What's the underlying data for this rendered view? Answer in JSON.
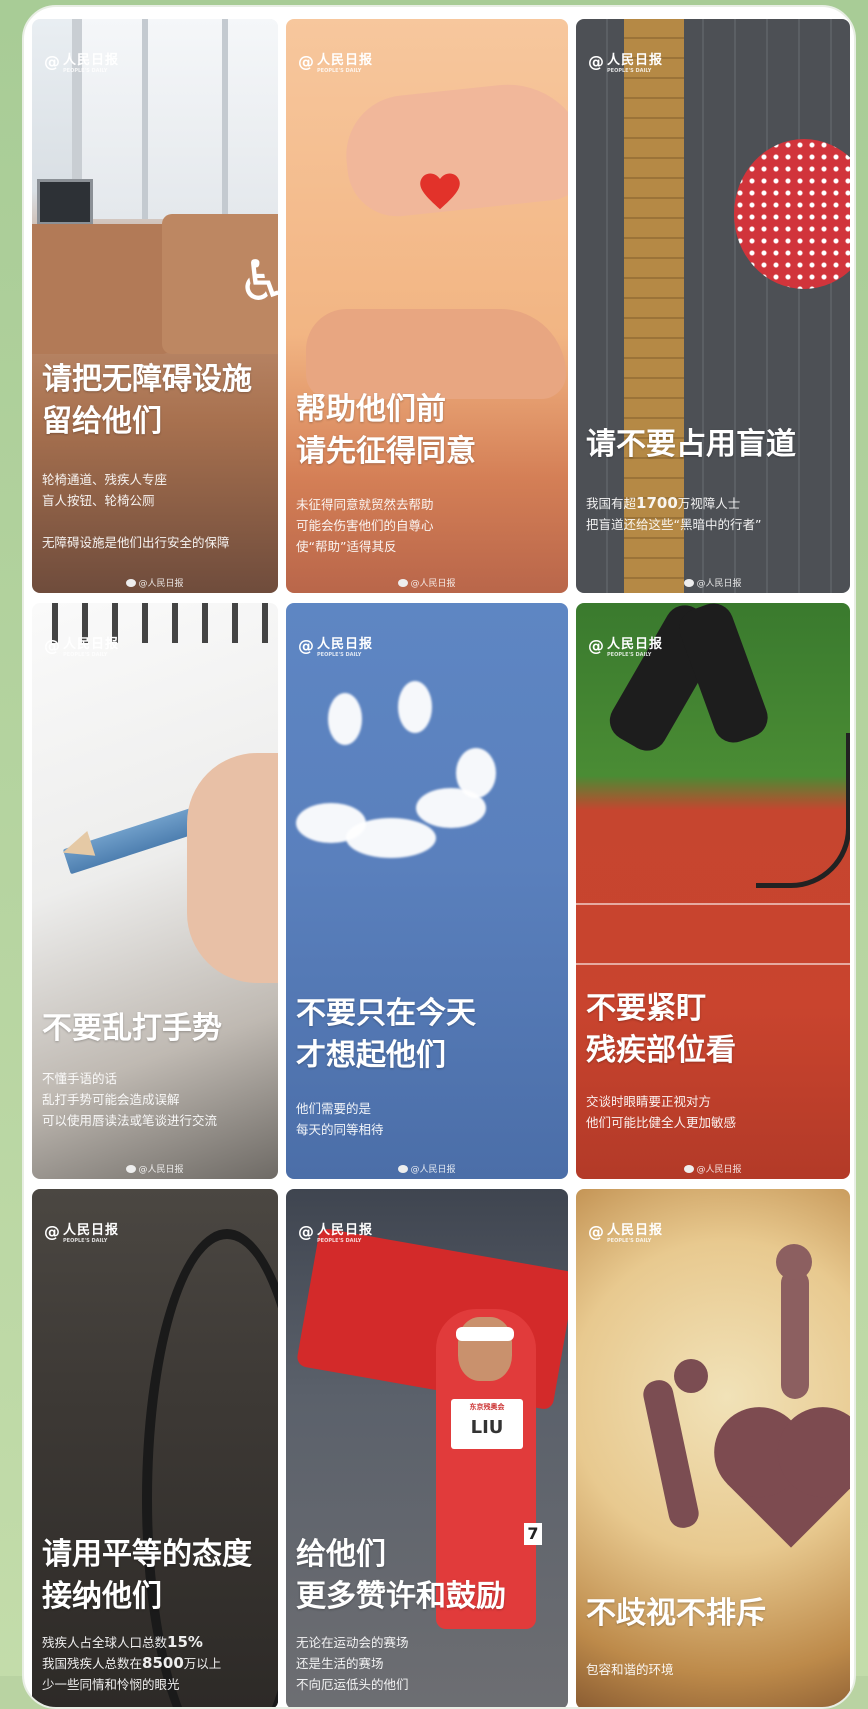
{
  "logo": {
    "at": "@",
    "name": "人民日报",
    "sub": "PEOPLE'S DAILY"
  },
  "watermark": "@人民日报",
  "cards": [
    {
      "headline": [
        "请把无障碍设施",
        "留给他们"
      ],
      "body": [
        "轮椅通道、残疾人专座",
        "盲人按钮、轮椅公厕",
        "",
        "无障碍设施是他们出行安全的保障"
      ]
    },
    {
      "headline": [
        "帮助他们前",
        "请先征得同意"
      ],
      "body": [
        "未征得同意就贸然去帮助",
        "可能会伤害他们的自尊心",
        "使“帮助”适得其反"
      ]
    },
    {
      "headline": [
        "请不要占用盲道"
      ],
      "body_prefix": "我国有超",
      "body_number": "1700",
      "body_suffix": "万视障人士",
      "body": [
        "把盲道还给这些“黑暗中的行者”"
      ]
    },
    {
      "headline": [
        "不要乱打手势"
      ],
      "body": [
        "不懂手语的话",
        "乱打手势可能会造成误解",
        "可以使用唇读法或笔谈进行交流"
      ]
    },
    {
      "headline": [
        "不要只在今天",
        "才想起他们"
      ],
      "body": [
        "他们需要的是",
        "每天的同等相待"
      ]
    },
    {
      "headline": [
        "不要紧盯",
        "残疾部位看"
      ],
      "body": [
        "交谈时眼睛要正视对方",
        "他们可能比健全人更加敏感"
      ]
    },
    {
      "headline": [
        "请用平等的态度",
        "接纳他们"
      ],
      "line1_prefix": "残疾人占全球人口总数",
      "line1_number": "15%",
      "line2_prefix": "我国残疾人总数在",
      "line2_number": "8500",
      "line2_suffix": "万以上",
      "body": [
        "少一些同情和怜悯的眼光"
      ]
    },
    {
      "headline": [
        "给他们",
        "更多赞许和鼓励"
      ],
      "bib_text": "LIU",
      "bib_sub": "东京残奥会",
      "bib_number": "7",
      "body": [
        "无论在运动会的赛场",
        "还是生活的赛场",
        "不向厄运低头的他们"
      ]
    },
    {
      "headline": [
        "不歧视不排斥"
      ],
      "body": [
        "包容和谐的环境"
      ]
    }
  ]
}
